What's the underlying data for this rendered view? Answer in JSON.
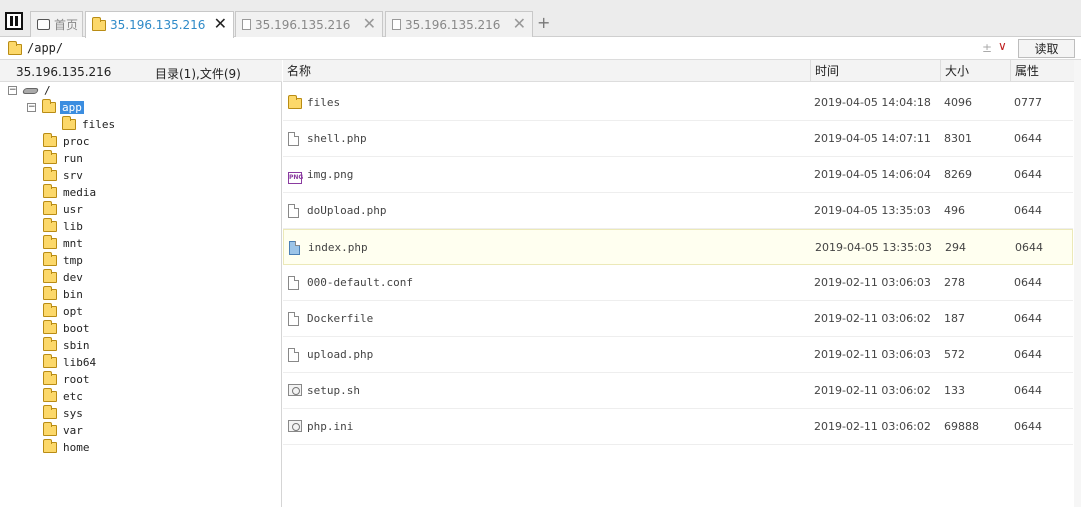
{
  "tabs": [
    {
      "label": "首页",
      "icon": "home-icon",
      "active": false
    },
    {
      "label": "35.196.135.216",
      "icon": "folder-icon",
      "active": true
    },
    {
      "label": "35.196.135.216",
      "icon": "page-icon",
      "active": false
    },
    {
      "label": "35.196.135.216",
      "icon": "page-icon",
      "active": false
    }
  ],
  "tab_close": "✕",
  "new_tab": "+",
  "pathbar": {
    "path": "/app/",
    "toggle": "±",
    "dropdown": "∨",
    "read_label": "读取"
  },
  "left_panel": {
    "host": "35.196.135.216",
    "count": "目录(1),文件(9)"
  },
  "tree": {
    "root": "/",
    "app": "app",
    "files": "files",
    "dirs": [
      "proc",
      "run",
      "srv",
      "media",
      "usr",
      "lib",
      "mnt",
      "tmp",
      "dev",
      "bin",
      "opt",
      "boot",
      "sbin",
      "lib64",
      "root",
      "etc",
      "sys",
      "var",
      "home"
    ]
  },
  "columns": {
    "name": "名称",
    "time": "时间",
    "size": "大小",
    "attr": "属性"
  },
  "files": [
    {
      "name": "files",
      "time": "2019-04-05 14:04:18",
      "size": "4096",
      "attr": "0777",
      "icon": "folder-icon"
    },
    {
      "name": "shell.php",
      "time": "2019-04-05 14:07:11",
      "size": "8301",
      "attr": "0644",
      "icon": "file-icon"
    },
    {
      "name": "img.png",
      "time": "2019-04-05 14:06:04",
      "size": "8269",
      "attr": "0644",
      "icon": "png-icon"
    },
    {
      "name": "doUpload.php",
      "time": "2019-04-05 13:35:03",
      "size": "496",
      "attr": "0644",
      "icon": "file-icon"
    },
    {
      "name": "index.php",
      "time": "2019-04-05 13:35:03",
      "size": "294",
      "attr": "0644",
      "icon": "text-file-icon"
    },
    {
      "name": "000-default.conf",
      "time": "2019-02-11 03:06:03",
      "size": "278",
      "attr": "0644",
      "icon": "file-icon"
    },
    {
      "name": "Dockerfile",
      "time": "2019-02-11 03:06:02",
      "size": "187",
      "attr": "0644",
      "icon": "file-icon"
    },
    {
      "name": "upload.php",
      "time": "2019-02-11 03:06:03",
      "size": "572",
      "attr": "0644",
      "icon": "file-icon"
    },
    {
      "name": "setup.sh",
      "time": "2019-02-11 03:06:02",
      "size": "133",
      "attr": "0644",
      "icon": "script-icon"
    },
    {
      "name": "php.ini",
      "time": "2019-02-11 03:06:02",
      "size": "69888",
      "attr": "0644",
      "icon": "settings-file-icon"
    }
  ]
}
